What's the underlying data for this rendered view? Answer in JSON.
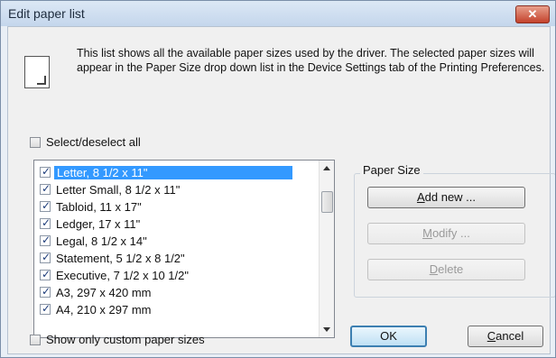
{
  "window": {
    "title": "Edit paper list",
    "close_glyph": "✕"
  },
  "description": "This list shows all the available paper sizes used by the driver. The selected paper sizes will appear in the Paper Size drop down list in the Device Settings tab of the Printing Preferences.",
  "select_all": {
    "label": "Select/deselect all",
    "checked": false
  },
  "papers": [
    {
      "label": "Letter, 8 1/2 x 11\"",
      "checked": true,
      "selected": true
    },
    {
      "label": "Letter Small, 8 1/2 x 11\"",
      "checked": true,
      "selected": false
    },
    {
      "label": "Tabloid, 11 x 17\"",
      "checked": true,
      "selected": false
    },
    {
      "label": "Ledger, 17 x 11\"",
      "checked": true,
      "selected": false
    },
    {
      "label": "Legal, 8 1/2 x 14\"",
      "checked": true,
      "selected": false
    },
    {
      "label": "Statement, 5 1/2 x 8 1/2\"",
      "checked": true,
      "selected": false
    },
    {
      "label": "Executive, 7 1/2 x 10 1/2\"",
      "checked": true,
      "selected": false
    },
    {
      "label": "A3, 297 x 420 mm",
      "checked": true,
      "selected": false
    },
    {
      "label": "A4, 210 x 297 mm",
      "checked": true,
      "selected": false
    }
  ],
  "paper_size_group": {
    "title": "Paper Size",
    "add_new": {
      "pre": "",
      "key": "A",
      "post": "dd new ..."
    },
    "modify": {
      "pre": "",
      "key": "M",
      "post": "odify ..."
    },
    "delete": {
      "pre": "",
      "key": "D",
      "post": "elete"
    }
  },
  "show_custom": {
    "label": "Show only custom paper sizes",
    "checked": false
  },
  "ok": "OK",
  "cancel": {
    "pre": "",
    "key": "C",
    "post": "ancel"
  },
  "colors": {
    "selection": "#3399ff",
    "title_bar": "#c4d6ec",
    "close_button": "#c4422c"
  }
}
